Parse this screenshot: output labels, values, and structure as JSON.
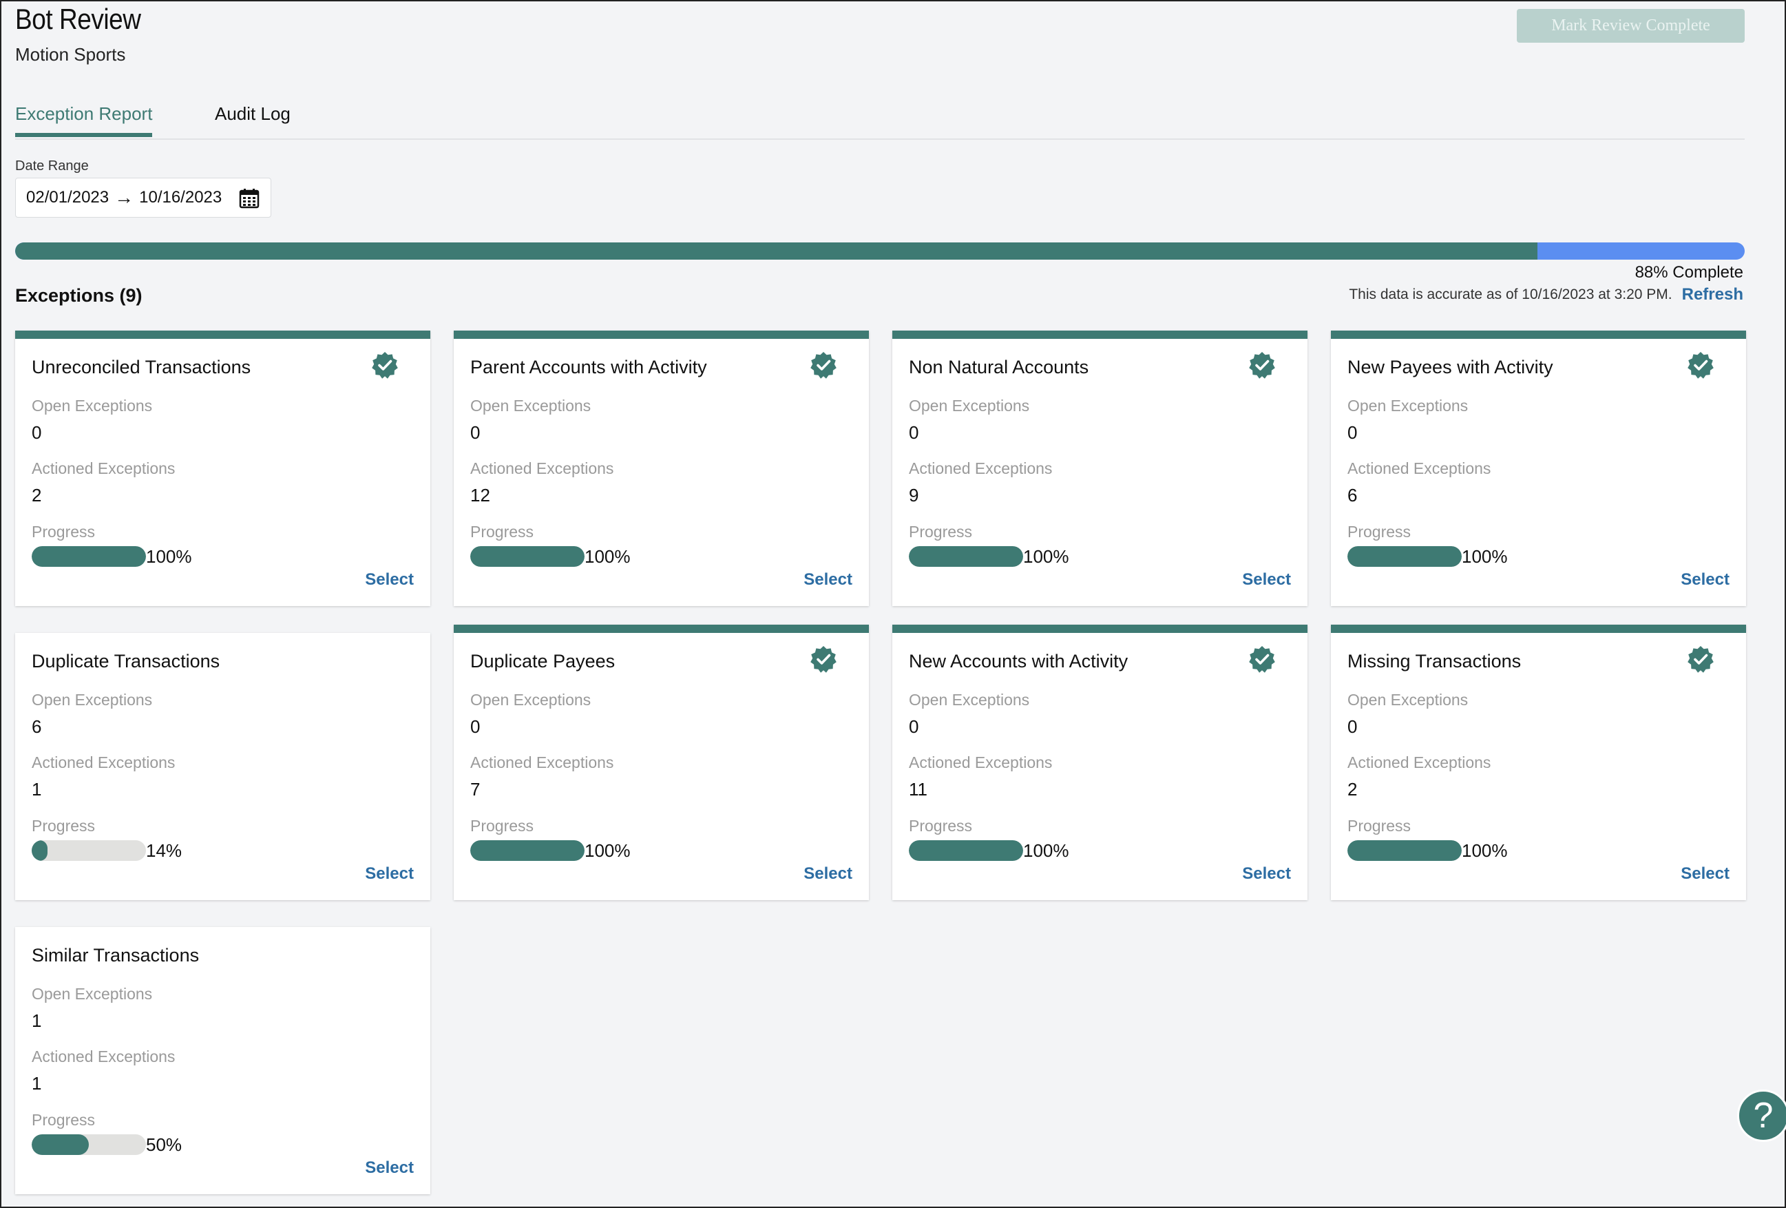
{
  "header": {
    "title": "Bot Review",
    "subtitle": "Motion Sports",
    "mark_complete_label": "Mark Review Complete"
  },
  "tabs": [
    {
      "label": "Exception Report",
      "active": true
    },
    {
      "label": "Audit Log",
      "active": false
    }
  ],
  "date_range": {
    "label": "Date Range",
    "start": "02/01/2023",
    "arrow": "→",
    "end": "10/16/2023"
  },
  "overall_progress": {
    "value": 88,
    "label": "88% Complete"
  },
  "exceptions": {
    "title": "Exceptions (9)",
    "accuracy_note": "This data is accurate as of 10/16/2023 at 3:20 PM.",
    "refresh_label": "Refresh"
  },
  "labels": {
    "open": "Open Exceptions",
    "actioned": "Actioned Exceptions",
    "progress": "Progress",
    "select": "Select"
  },
  "cards": [
    {
      "title": "Unreconciled Transactions",
      "open": "0",
      "actioned": "2",
      "progress": 100,
      "progress_label": "100%",
      "complete": true
    },
    {
      "title": "Parent Accounts with Activity",
      "open": "0",
      "actioned": "12",
      "progress": 100,
      "progress_label": "100%",
      "complete": true
    },
    {
      "title": "Non Natural Accounts",
      "open": "0",
      "actioned": "9",
      "progress": 100,
      "progress_label": "100%",
      "complete": true
    },
    {
      "title": "New Payees with Activity",
      "open": "0",
      "actioned": "6",
      "progress": 100,
      "progress_label": "100%",
      "complete": true
    },
    {
      "title": "Duplicate Transactions",
      "open": "6",
      "actioned": "1",
      "progress": 14,
      "progress_label": "14%",
      "complete": false
    },
    {
      "title": "Duplicate Payees",
      "open": "0",
      "actioned": "7",
      "progress": 100,
      "progress_label": "100%",
      "complete": true
    },
    {
      "title": "New Accounts with Activity",
      "open": "0",
      "actioned": "11",
      "progress": 100,
      "progress_label": "100%",
      "complete": true
    },
    {
      "title": "Missing Transactions",
      "open": "0",
      "actioned": "2",
      "progress": 100,
      "progress_label": "100%",
      "complete": true
    },
    {
      "title": "Similar Transactions",
      "open": "1",
      "actioned": "1",
      "progress": 50,
      "progress_label": "50%",
      "complete": false
    }
  ],
  "help": {
    "icon": "question-icon",
    "glyph": "?"
  },
  "colors": {
    "accent": "#3e7a73",
    "remaining": "#5b8ef1",
    "link": "#2d6da3",
    "track": "#e1e1df"
  }
}
